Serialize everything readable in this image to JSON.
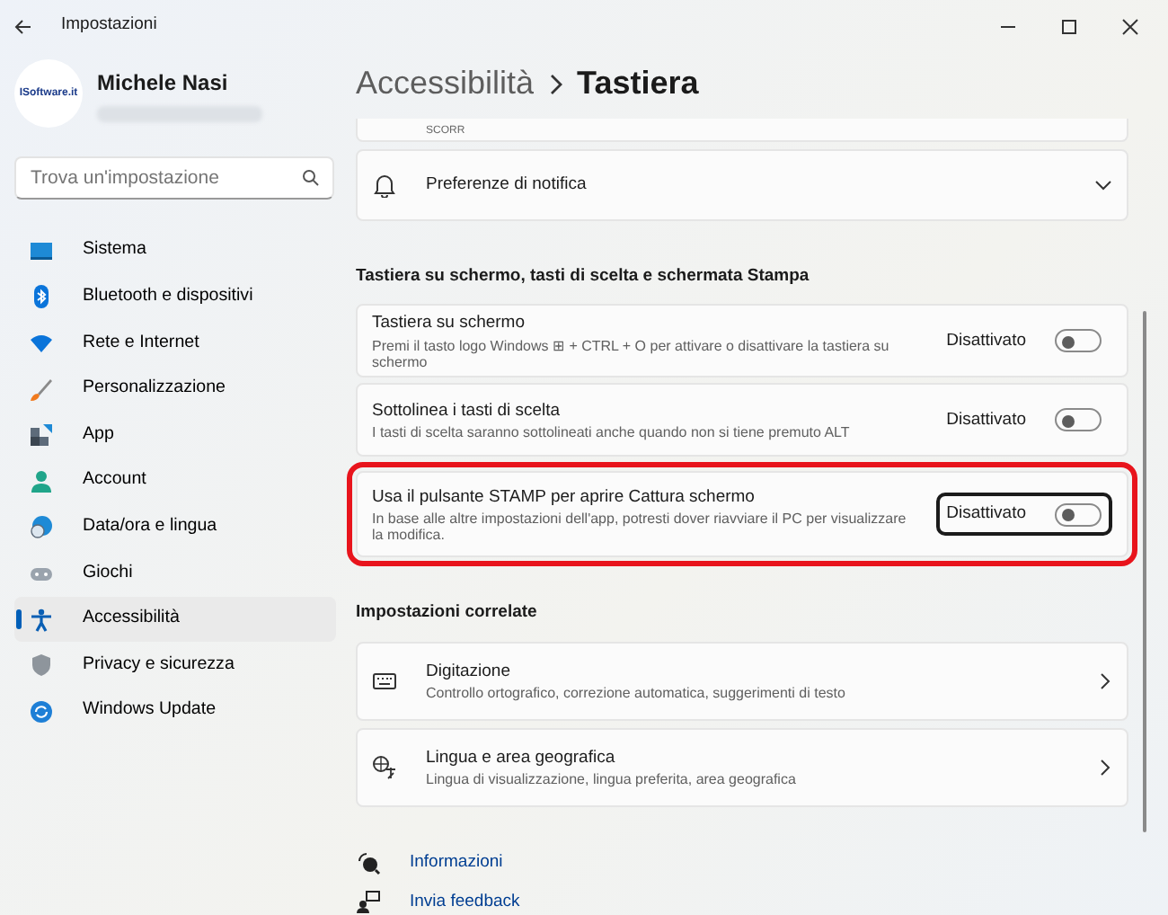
{
  "window": {
    "title": "Impostazioni"
  },
  "user": {
    "name": "Michele Nasi",
    "logo_text": "ISoftware.it"
  },
  "search": {
    "placeholder": "Trova un'impostazione"
  },
  "nav": [
    {
      "label": "Sistema",
      "selected": false
    },
    {
      "label": "Bluetooth e dispositivi",
      "selected": false
    },
    {
      "label": "Rete e Internet",
      "selected": false
    },
    {
      "label": "Personalizzazione",
      "selected": false
    },
    {
      "label": "App",
      "selected": false
    },
    {
      "label": "Account",
      "selected": false
    },
    {
      "label": "Data/ora e lingua",
      "selected": false
    },
    {
      "label": "Giochi",
      "selected": false
    },
    {
      "label": "Accessibilità",
      "selected": true
    },
    {
      "label": "Privacy e sicurezza",
      "selected": false
    },
    {
      "label": "Windows Update",
      "selected": false
    }
  ],
  "breadcrumb": [
    "Accessibilità",
    "Tastiera"
  ],
  "partial_card": {
    "text": "SCORR"
  },
  "notification_card": {
    "label": "Preferenze di notifica",
    "expanded": false
  },
  "section_title": "Tastiera su schermo, tasti di scelta e schermata Stampa",
  "toggles": [
    {
      "title": "Tastiera su schermo",
      "description": "Premi il tasto logo Windows ⊞ + CTRL + O per attivare o disattivare la tastiera su schermo",
      "state_label": "Disattivato",
      "on": false,
      "highlighted": false,
      "focused": false
    },
    {
      "title": "Sottolinea i tasti di scelta",
      "description": "I tasti di scelta saranno sottolineati anche quando non si tiene premuto ALT",
      "state_label": "Disattivato",
      "on": false,
      "highlighted": false,
      "focused": false
    },
    {
      "title": "Usa il pulsante STAMP per aprire Cattura schermo",
      "description": "In base alle altre impostazioni dell'app, potresti dover riavviare il PC per visualizzare la modifica.",
      "state_label": "Disattivato",
      "on": false,
      "highlighted": true,
      "focused": true
    }
  ],
  "related": {
    "title": "Impostazioni correlate",
    "items": [
      {
        "title": "Digitazione",
        "description": "Controllo ortografico, correzione automatica, suggerimenti di testo"
      },
      {
        "title": "Lingua e area geografica",
        "description": "Lingua di visualizzazione, lingua preferita, area geografica"
      }
    ]
  },
  "links": [
    {
      "label": "Informazioni"
    },
    {
      "label": "Invia feedback"
    }
  ]
}
